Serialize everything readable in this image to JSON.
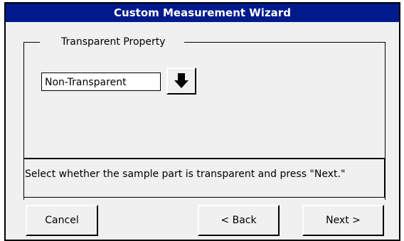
{
  "window": {
    "title": "Custom Measurement Wizard",
    "title_bar_color": "#001a8c"
  },
  "group": {
    "label": "Transparent Property"
  },
  "transparency_select": {
    "value": "Non-Transparent",
    "dropdown_icon": "arrow-down-icon"
  },
  "instruction": "Select whether the sample part is transparent and press \"Next.\"",
  "buttons": {
    "cancel": "Cancel",
    "back": "< Back",
    "next": "Next >"
  }
}
